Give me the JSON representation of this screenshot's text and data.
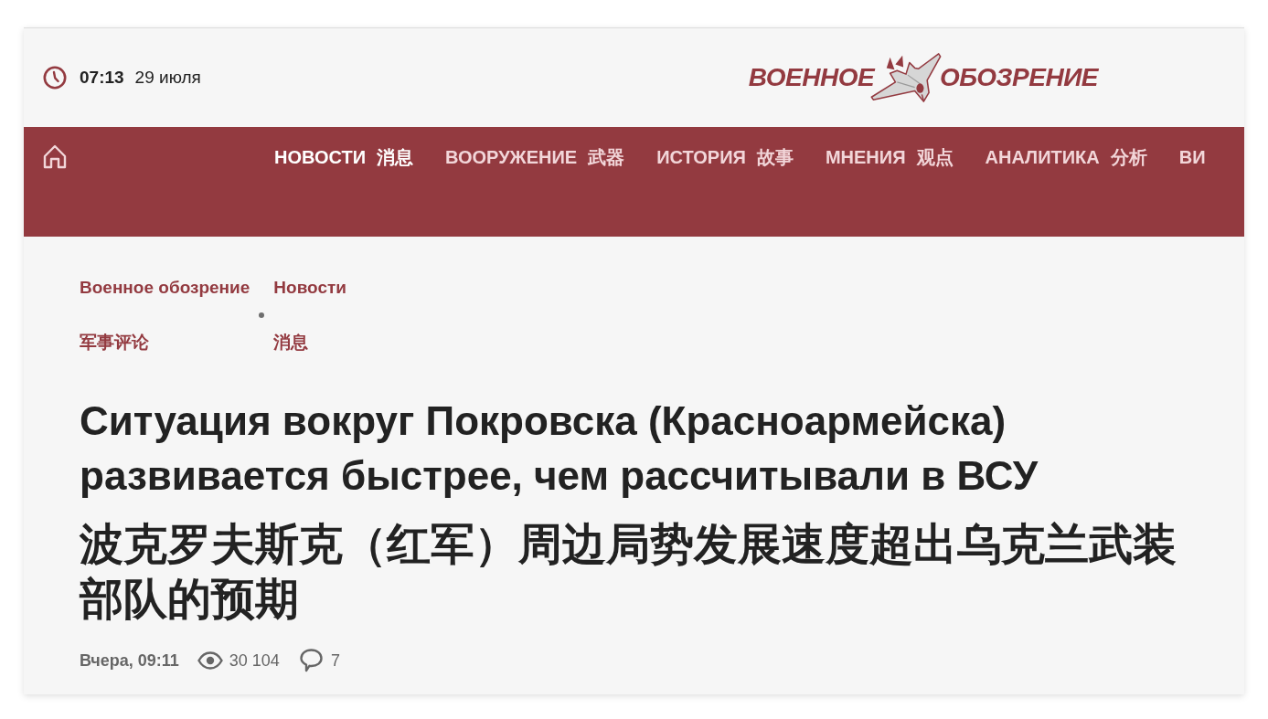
{
  "header": {
    "time": "07:13",
    "date": "29 июля",
    "logo": {
      "left": "ВОЕННОЕ",
      "right": "ОБОЗРЕНИЕ"
    }
  },
  "nav": {
    "items": [
      {
        "label": "НОВОСТИ",
        "label_zh": "消息",
        "selected": true
      },
      {
        "label": "ВООРУЖЕНИЕ",
        "label_zh": "武器",
        "selected": false
      },
      {
        "label": "ИСТОРИЯ",
        "label_zh": "故事",
        "selected": false
      },
      {
        "label": "МНЕНИЯ",
        "label_zh": "观点",
        "selected": false
      },
      {
        "label": "АНАЛИТИКА",
        "label_zh": "分析",
        "selected": false
      },
      {
        "label": "ВИ",
        "selected": false
      }
    ]
  },
  "breadcrumbs": [
    {
      "label": "Военное обозрение",
      "label_zh": "军事评论"
    },
    {
      "label": "Новости",
      "label_zh": "消息"
    }
  ],
  "article": {
    "title": "Ситуация вокруг Покровска (Красноармейска) развивается быстрее, чем рассчитывали в ВСУ",
    "title_zh": "波克罗夫斯克（红军）周边局势发展速度超出乌克兰武装部队的预期",
    "date": "Вчера, 09:11",
    "views": "30 104",
    "comments": "7"
  }
}
